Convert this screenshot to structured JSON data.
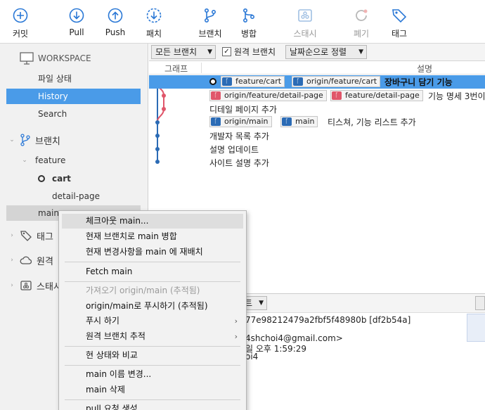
{
  "toolbar": {
    "commit": "커밋",
    "pull": "Pull",
    "push": "Push",
    "fetch": "패치",
    "branch": "브랜치",
    "merge": "병합",
    "stash": "스태시",
    "discard": "폐기",
    "tag": "태그"
  },
  "sidebar": {
    "workspace": "WORKSPACE",
    "file_status": "파일 상태",
    "history": "History",
    "search": "Search",
    "branches": "브랜치",
    "feature": "feature",
    "cart": "cart",
    "detail_page": "detail-page",
    "main": "main",
    "tags": "태그",
    "remotes": "원격",
    "stashes": "스태시"
  },
  "filterbar": {
    "all_branches": "모든 브랜치",
    "remote_branches": "원격 브랜치",
    "sort": "날짜순으로 정렬"
  },
  "columns": {
    "graph": "그래프",
    "description": "설명"
  },
  "commits": [
    {
      "tags": [
        "feature/cart",
        "origin/feature/cart"
      ],
      "message": "장바구니 담기 기능"
    },
    {
      "tags": [
        "origin/feature/detail-page",
        "feature/detail-page"
      ],
      "message": "기능 명세 3번이"
    },
    {
      "tags": [],
      "message": "디테일 페이지 추가"
    },
    {
      "tags": [
        "origin/main",
        "main"
      ],
      "message": "티스쳐, 기능 리스트 추가"
    },
    {
      "tags": [],
      "message": "개발자 목록 추가"
    },
    {
      "tags": [],
      "message": "설명 업데이트"
    },
    {
      "tags": [],
      "message": "사이트 설명 추가"
    }
  ],
  "details": {
    "hash": "77e98212479a2fbf5f48980b [df2b54a]",
    "email": "4shchoi4@gmail.com>",
    "date": "일 오후 1:59:29",
    "author": "oi4",
    "lower_dd": "트"
  },
  "context_menu": {
    "checkout": "체크아웃 main...",
    "merge_into_current": "현재 브랜치로 main 병합",
    "rebase": "현재 변경사항을 main 에 재배치",
    "fetch": "Fetch main",
    "pull_tracked": "가져오기 origin/main (추적됨)",
    "push_tracked": "origin/main로 푸시하기 (추적됨)",
    "push_to": "푸시 하기",
    "track_remote": "원격 브랜치 추적",
    "diff": "현 상태와 비교",
    "rename": "main 이름 변경...",
    "delete": "main 삭제",
    "pull_request": "pull 요청 생성..."
  },
  "colors": {
    "selection": "#4a9be8",
    "branch_blue": "#2b6bb5",
    "branch_red": "#e0566a"
  }
}
